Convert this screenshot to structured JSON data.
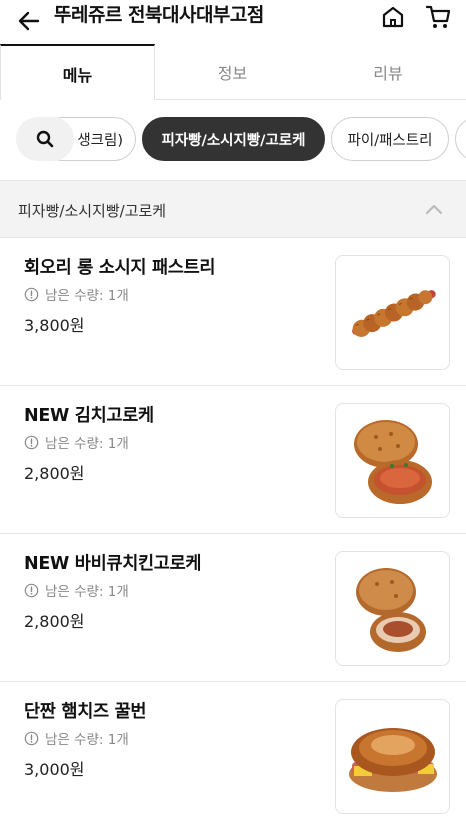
{
  "header": {
    "title": "뚜레쥬르 전북대사대부고점",
    "back_icon": "arrow-left-icon",
    "home_icon": "home-icon",
    "cart_icon": "cart-icon"
  },
  "tabs": [
    {
      "label": "메뉴",
      "active": true
    },
    {
      "label": "정보",
      "active": false
    },
    {
      "label": "리뷰",
      "active": false
    }
  ],
  "categories": {
    "search_icon": "search-icon",
    "chips": [
      {
        "label": "생크림)",
        "active": false
      },
      {
        "label": "피자빵/소시지빵/고로케",
        "active": true
      },
      {
        "label": "파이/패스트리",
        "active": false
      },
      {
        "label": "",
        "active": false
      }
    ]
  },
  "section": {
    "title": "피자빵/소시지빵/고로케",
    "collapse_icon": "chevron-up-icon"
  },
  "products": [
    {
      "name": "회오리 롱 소시지 패스트리",
      "stock": "남은 수량: 1개",
      "price": "3,800원",
      "image": "sausage-pastry"
    },
    {
      "name": "NEW 김치고로케",
      "stock": "남은 수량: 1개",
      "price": "2,800원",
      "image": "croquette"
    },
    {
      "name": "NEW 바비큐치킨고로케",
      "stock": "남은 수량: 1개",
      "price": "2,800원",
      "image": "croquette"
    },
    {
      "name": "단짠 햄치즈 꿀번",
      "stock": "남은 수량: 1개",
      "price": "3,000원",
      "image": "ham-cheese-bun"
    }
  ],
  "colors": {
    "active_chip_bg": "#333333",
    "muted_text": "#888888",
    "section_bg": "#f3f3f3"
  }
}
